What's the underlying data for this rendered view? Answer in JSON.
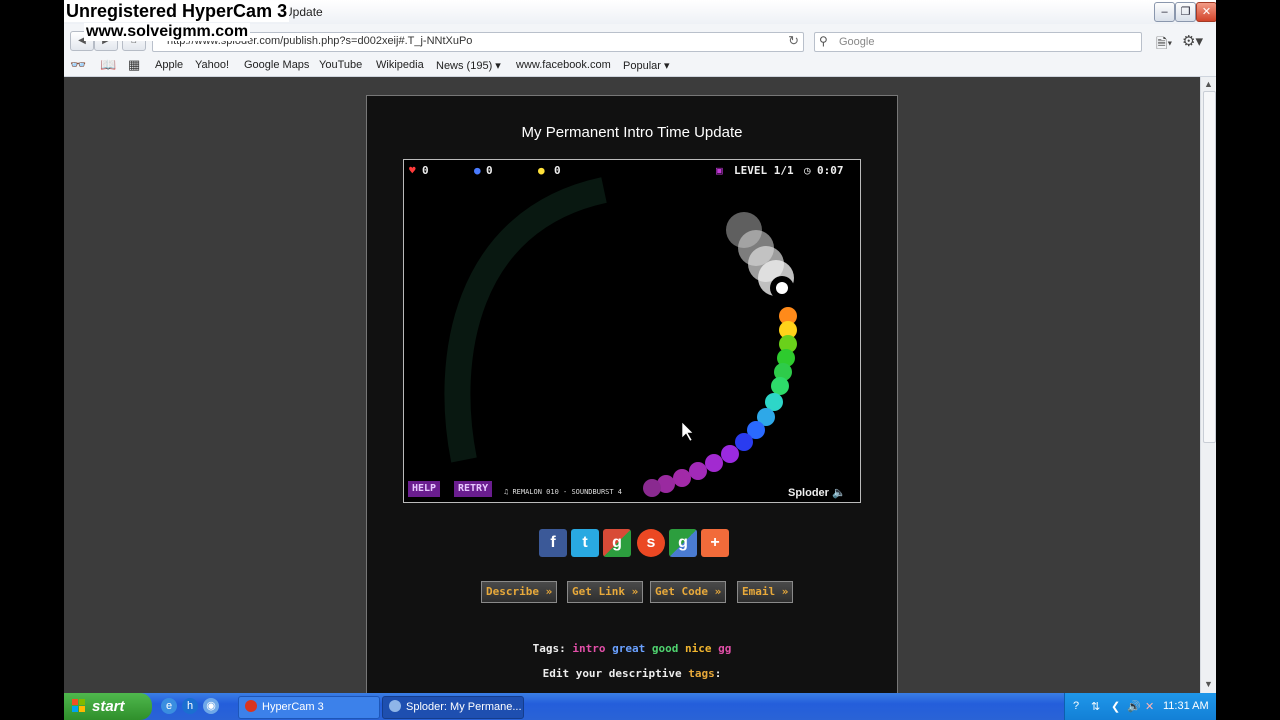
{
  "watermark": {
    "line1": "Unregistered HyperCam 3",
    "line2": "www.solveigmm.com"
  },
  "browser": {
    "title": "Update",
    "url": "http://www.sploder.com/publish.php?s=d002xeij#.T_j-NNtXuPo",
    "search_placeholder": "Google",
    "bookmarks": [
      "Apple",
      "Yahoo!",
      "Google Maps",
      "YouTube",
      "Wikipedia",
      "News (195)",
      "www.facebook.com",
      "Popular"
    ]
  },
  "page": {
    "title": "My Permanent Intro Time Update",
    "game": {
      "hearts": "0",
      "blue_count": "0",
      "yellow_count": "0",
      "level": "LEVEL 1/1",
      "time": "0:07",
      "help": "HELP",
      "retry": "RETRY",
      "music": "REMALON 010 - SOUNDBURST 4",
      "brand": "Sploder"
    },
    "actions": [
      "Describe »",
      "Get Link »",
      "Get Code »",
      "Email »"
    ],
    "tags_label": "Tags:",
    "tags": [
      {
        "text": "intro",
        "color": "#e24fa8"
      },
      {
        "text": "great",
        "color": "#6aa0ff"
      },
      {
        "text": "good",
        "color": "#4fd36f"
      },
      {
        "text": "nice",
        "color": "#f0b52f"
      },
      {
        "text": "gg",
        "color": "#e24fa8"
      }
    ],
    "edit_tags_prefix": "Edit your descriptive",
    "edit_tags_word": "tags",
    "edit_tags_suffix": ":"
  },
  "taskbar": {
    "start": "start",
    "tasks": [
      "HyperCam 3",
      "Sploder: My Permane..."
    ],
    "clock": "11:31 AM"
  }
}
